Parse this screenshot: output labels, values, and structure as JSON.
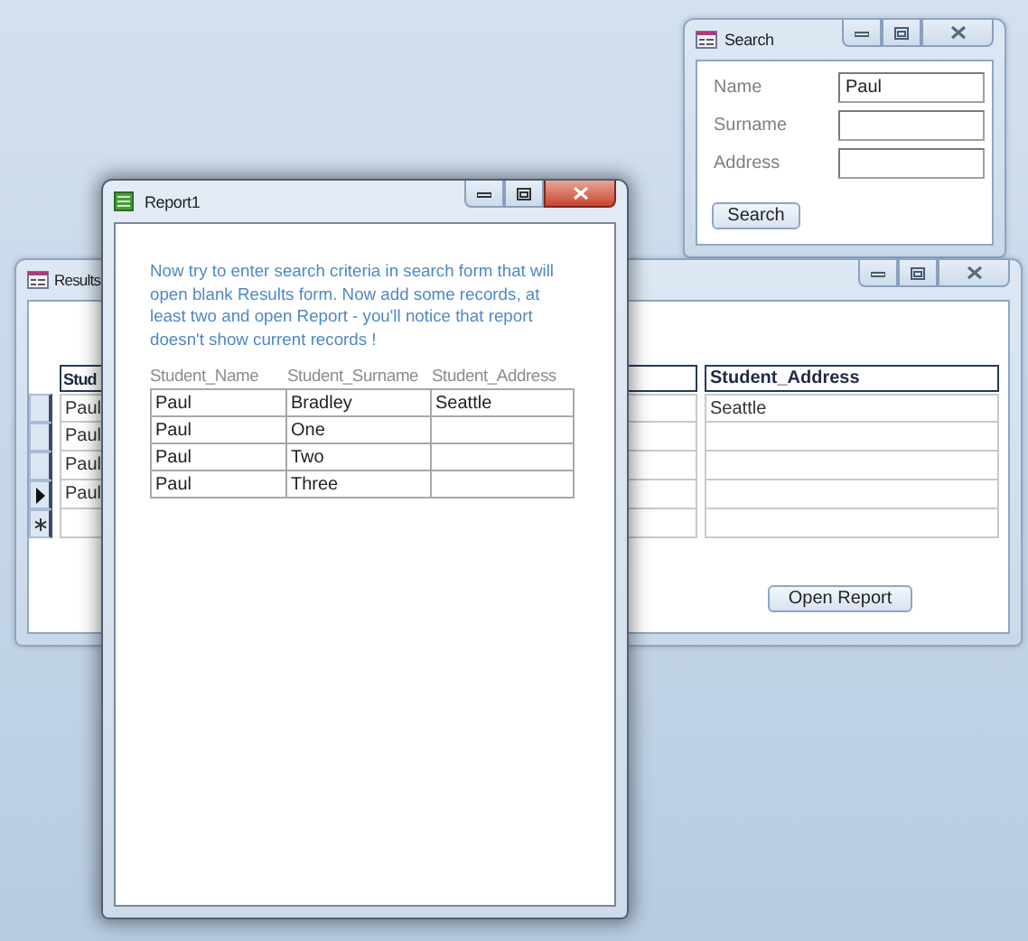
{
  "search_window": {
    "title": "Search",
    "active": false,
    "fields": [
      {
        "label": "Name",
        "value": "Paul"
      },
      {
        "label": "Surname"
      },
      {
        "label": "Address"
      }
    ],
    "button": "Search"
  },
  "results_window": {
    "title": "Results",
    "active": false,
    "columns": [
      "Stud",
      "Student_Address"
    ],
    "rows": [
      {
        "kind": "record",
        "name": "Paul",
        "address": "Seattle",
        "current": false
      },
      {
        "kind": "record",
        "name": "Paul",
        "current": false
      },
      {
        "kind": "record",
        "name": "Paul",
        "current": false
      },
      {
        "kind": "record",
        "name": "Paul",
        "current": true
      },
      {
        "kind": "new",
        "current": false
      }
    ],
    "button": "Open Report"
  },
  "report_window": {
    "title": "Report1",
    "active": true,
    "note": "Now try to enter search criteria in search form that will open blank Results form. Now add some records, at least two and open Report - you'll notice that report doesn't show current records !",
    "columns": [
      "Student_Name",
      "Student_Surname",
      "Student_Address"
    ],
    "rows": [
      {
        "name": "Paul",
        "surname": "Bradley",
        "address": "Seattle"
      },
      {
        "name": "Paul",
        "surname": "One"
      },
      {
        "name": "Paul",
        "surname": "Two"
      },
      {
        "name": "Paul",
        "surname": "Three"
      }
    ]
  }
}
